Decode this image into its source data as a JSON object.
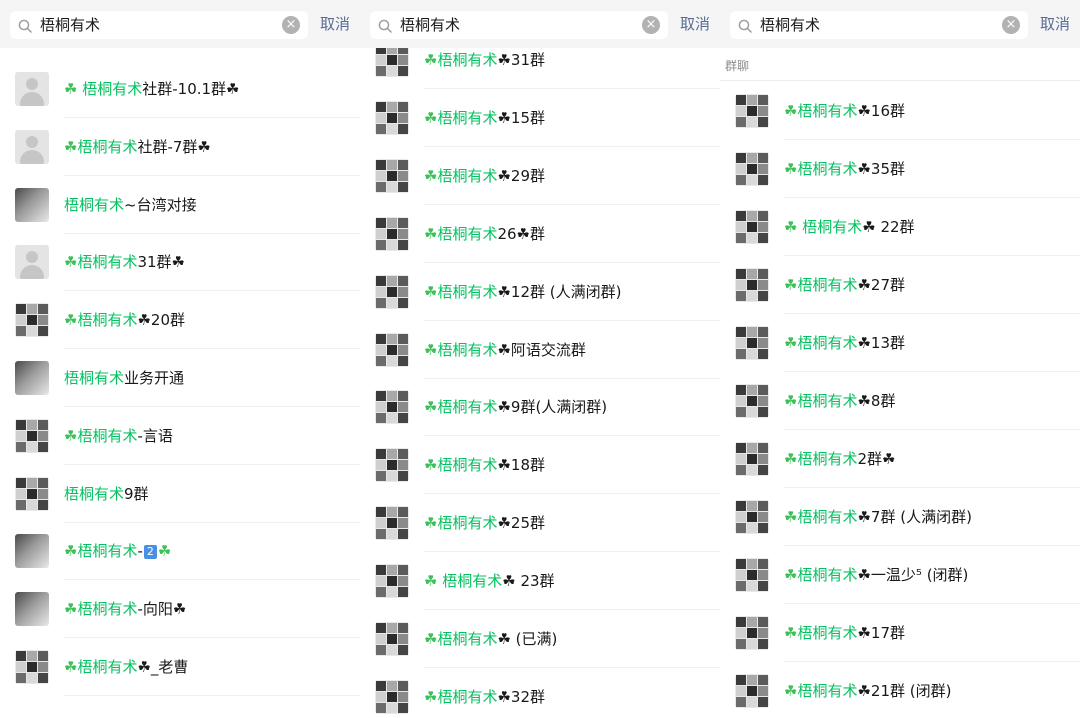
{
  "colors": {
    "highlight": "#07c160",
    "clover": "#3fbf5a",
    "cancel": "#576b95"
  },
  "panels": [
    {
      "search": {
        "value": "梧桐有术",
        "cancel": "取消",
        "clear_icon": "clear-circle-icon",
        "search_icon": "search-icon"
      },
      "section_label": "",
      "rows": [
        {
          "avatar": "default",
          "before": "☘ ",
          "hl": "梧桐有术",
          "after": "社群-10.1群☘"
        },
        {
          "avatar": "default",
          "before": "☘",
          "hl": "梧桐有术",
          "after": "社群-7群☘"
        },
        {
          "avatar": "photo",
          "before": "",
          "hl": "梧桐有术",
          "after": "~台湾对接"
        },
        {
          "avatar": "default",
          "before": "☘",
          "hl": "梧桐有术",
          "after": "31群☘"
        },
        {
          "avatar": "grid",
          "before": "☘",
          "hl": "梧桐有术",
          "after": "☘20群"
        },
        {
          "avatar": "photo",
          "before": "",
          "hl": "梧桐有术",
          "after": "业务开通"
        },
        {
          "avatar": "grid",
          "before": "☘",
          "hl": "梧桐有术",
          "after": "-言语"
        },
        {
          "avatar": "grid",
          "before": "",
          "hl": "梧桐有术",
          "after": "9群"
        },
        {
          "avatar": "photo",
          "before": "☘",
          "hl": "梧桐有术",
          "after": "-",
          "box": "2",
          "after2": "☘"
        },
        {
          "avatar": "photo",
          "before": "☘",
          "hl": "梧桐有术",
          "after": "-向阳☘"
        },
        {
          "avatar": "grid",
          "before": "☘",
          "hl": "梧桐有术",
          "after": "☘_老曹"
        }
      ]
    },
    {
      "search": {
        "value": "梧桐有术",
        "cancel": "取消",
        "clear_icon": "clear-circle-icon",
        "search_icon": "search-icon"
      },
      "section_label": "",
      "rows": [
        {
          "avatar": "grid",
          "before": "☘",
          "hl": "梧桐有术",
          "after": "☘31群"
        },
        {
          "avatar": "grid",
          "before": "☘",
          "hl": "梧桐有术",
          "after": "☘15群"
        },
        {
          "avatar": "grid",
          "before": "☘",
          "hl": "梧桐有术",
          "after": "☘29群"
        },
        {
          "avatar": "grid",
          "before": "☘",
          "hl": "梧桐有术",
          "after": "26☘群"
        },
        {
          "avatar": "grid",
          "before": "☘",
          "hl": "梧桐有术",
          "after": "☘12群 (人满闭群)"
        },
        {
          "avatar": "grid",
          "before": "☘",
          "hl": "梧桐有术",
          "after": "☘阿语交流群"
        },
        {
          "avatar": "grid",
          "before": "☘",
          "hl": "梧桐有术",
          "after": "☘9群(人满闭群)"
        },
        {
          "avatar": "grid",
          "before": "☘",
          "hl": "梧桐有术",
          "after": "☘18群"
        },
        {
          "avatar": "grid",
          "before": "☘",
          "hl": "梧桐有术",
          "after": "☘25群"
        },
        {
          "avatar": "grid",
          "before": "☘ ",
          "hl": "梧桐有术",
          "after": "☘ 23群"
        },
        {
          "avatar": "grid",
          "before": "☘",
          "hl": "梧桐有术",
          "after": "☘ (已满)"
        },
        {
          "avatar": "grid",
          "before": "☘",
          "hl": "梧桐有术",
          "after": "☘32群"
        }
      ]
    },
    {
      "search": {
        "value": "梧桐有术",
        "cancel": "取消",
        "clear_icon": "clear-circle-icon",
        "search_icon": "search-icon"
      },
      "section_label": "群聊",
      "rows": [
        {
          "avatar": "grid",
          "before": "☘",
          "hl": "梧桐有术",
          "after": "☘16群"
        },
        {
          "avatar": "grid",
          "before": "☘",
          "hl": "梧桐有术",
          "after": "☘35群"
        },
        {
          "avatar": "grid",
          "before": "☘ ",
          "hl": "梧桐有术",
          "after": "☘ 22群"
        },
        {
          "avatar": "grid",
          "before": "☘",
          "hl": "梧桐有术",
          "after": "☘27群"
        },
        {
          "avatar": "grid",
          "before": "☘",
          "hl": "梧桐有术",
          "after": "☘13群"
        },
        {
          "avatar": "grid",
          "before": "☘",
          "hl": "梧桐有术",
          "after": "☘8群"
        },
        {
          "avatar": "grid",
          "before": "☘",
          "hl": "梧桐有术",
          "after": "2群☘"
        },
        {
          "avatar": "grid",
          "before": "☘",
          "hl": "梧桐有术",
          "after": "☘7群 (人满闭群)"
        },
        {
          "avatar": "grid",
          "before": "☘",
          "hl": "梧桐有术",
          "after": "☘一温少⁵ (闭群)"
        },
        {
          "avatar": "grid",
          "before": "☘",
          "hl": "梧桐有术",
          "after": "☘17群"
        },
        {
          "avatar": "grid",
          "before": "☘",
          "hl": "梧桐有术",
          "after": "☘21群 (闭群)"
        }
      ]
    }
  ]
}
